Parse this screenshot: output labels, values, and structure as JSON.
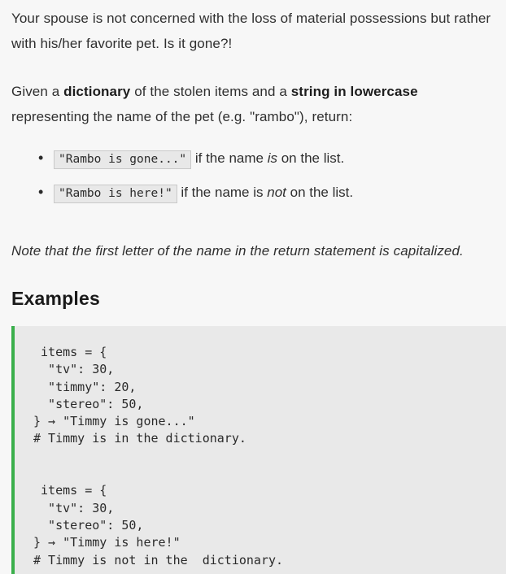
{
  "colors": {
    "page_background": "#f7f7f7",
    "text": "#2f2f2f",
    "code_block_background": "#e9e9e9",
    "code_block_accent": "#3aaf4b",
    "inline_code_background": "#e8e8e8",
    "inline_code_border": "#c9c9c9"
  },
  "content": {
    "paragraph_1": {
      "line_1": "Your spouse is not concerned with the loss of material possessions",
      "line_2": "but rather with his/her favorite pet. Is it gone?!",
      "full": "Your spouse is not concerned with the loss of material possessions but rather with his/her favorite pet. Is it gone?!"
    },
    "paragraph_2": {
      "part_1": "Given a ",
      "bold_1": "dictionary",
      "part_2": " of the stolen items and a ",
      "bold_2": "string in lowercase",
      "part_3": " representing the name of the pet (e.g. \"rambo\"), return:"
    },
    "bullets": [
      {
        "code": "\"Rambo is gone...\"",
        "text_before_em": " if the name ",
        "em": "is",
        "text_after_em": " on the list."
      },
      {
        "code": "\"Rambo is here!\"",
        "text_before_em": " if the name is ",
        "em": "not",
        "text_after_em": " on the list."
      }
    ],
    "note": "Note that the first letter of the name in the return statement is capitalized.",
    "examples_heading": "Examples",
    "code_block": " items = {\n  \"tv\": 30,\n  \"timmy\": 20,\n  \"stereo\": 50,\n} → \"Timmy is gone...\"\n# Timmy is in the dictionary.\n\n\n items = {\n  \"tv\": 30,\n  \"stereo\": 50,\n} → \"Timmy is here!\"\n# Timmy is not in the  dictionary.",
    "code_block_lines": [
      " items = {",
      "  \"tv\": 30,",
      "  \"timmy\": 20,",
      "  \"stereo\": 50,",
      "} → \"Timmy is gone...\"",
      "# Timmy is in the dictionary.",
      "",
      "",
      " items = {",
      "  \"tv\": 30,",
      "  \"stereo\": 50,",
      "} → \"Timmy is here!\"",
      "# Timmy is not in the  dictionary."
    ],
    "examples_data": [
      {
        "dictionary": {
          "tv": 30,
          "timmy": 20,
          "stereo": 50
        },
        "result": "\"Timmy is gone...\"",
        "comment": "# Timmy is in the dictionary."
      },
      {
        "dictionary": {
          "tv": 30,
          "stereo": 50
        },
        "result": "\"Timmy is here!\"",
        "comment": "# Timmy is not in the  dictionary."
      }
    ]
  }
}
